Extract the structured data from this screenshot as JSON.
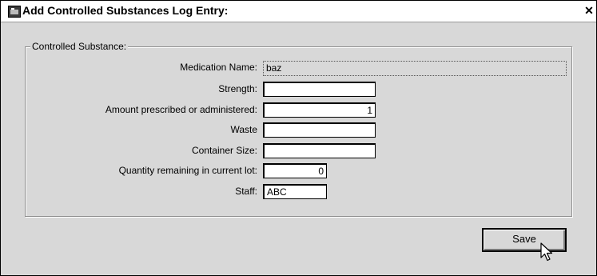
{
  "window": {
    "title": "Add Controlled Substances Log Entry:",
    "close_glyph": "✕",
    "app_icon": "application-icon",
    "close_icon": "close-icon"
  },
  "group": {
    "legend": "Controlled Substance:"
  },
  "fields": {
    "medication_name": {
      "label": "Medication Name:",
      "value": "baz"
    },
    "strength": {
      "label": "Strength:",
      "value": ""
    },
    "amount": {
      "label": "Amount prescribed or administered:",
      "value": "1"
    },
    "waste": {
      "label": "Waste",
      "value": ""
    },
    "container_size": {
      "label": "Container Size:",
      "value": ""
    },
    "quantity_remaining": {
      "label": "Quantity remaining in current lot:",
      "value": "0"
    },
    "staff": {
      "label": "Staff:",
      "value": "ABC"
    }
  },
  "buttons": {
    "save": "Save"
  },
  "cursor": "arrow-cursor-icon"
}
